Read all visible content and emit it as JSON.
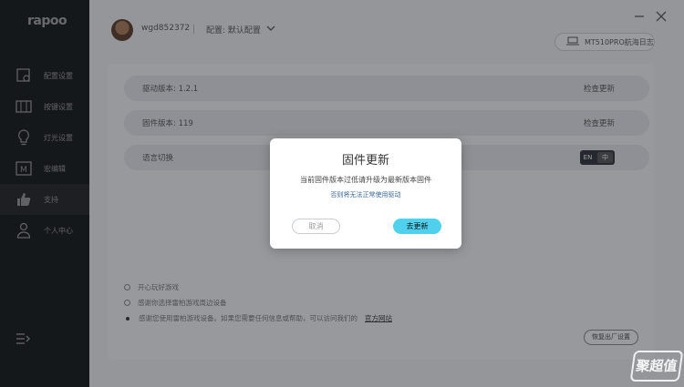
{
  "app": {
    "logo": "rapoo"
  },
  "sidebar": {
    "items": [
      {
        "label": "配置设置",
        "icon": "profile-settings-icon"
      },
      {
        "label": "按键设置",
        "icon": "keyboard-icon"
      },
      {
        "label": "灯光设置",
        "icon": "lightbulb-icon"
      },
      {
        "label": "宏编辑",
        "icon": "macro-icon"
      },
      {
        "label": "支持",
        "icon": "thumbs-up-icon",
        "active": true
      },
      {
        "label": "个人中心",
        "icon": "user-icon"
      }
    ],
    "bottom_icon": "collapse-menu-icon"
  },
  "header": {
    "username": "wgd852372",
    "profile_label": "配置: 默认配置",
    "log_button": "MT510PRO航海日志"
  },
  "support": {
    "driver_version": "驱动版本: 1.2.1",
    "driver_check": "检查更新",
    "firmware_version": "固件版本: 119",
    "firmware_check": "检查更新",
    "language_label": "语言切换",
    "lang_en": "EN",
    "lang_zh": "中",
    "notes": [
      "开心玩好游戏",
      "感谢你选择雷柏游戏周边设备",
      "感谢您使用雷柏游戏设备。如果您需要任何信息或帮助，可以访问我们的"
    ],
    "notes_link": "官方网站",
    "reset_button": "恢复出厂设置"
  },
  "dialog": {
    "title": "固件更新",
    "message": "当前固件版本过低请升级为最新版本固件",
    "sub_message": "否则将无法正常使用驱动",
    "cancel": "取消",
    "confirm": "去更新"
  },
  "watermark": "聚超值",
  "colors": {
    "accent": "#4fd1ee",
    "sidebar": "#1d1f22"
  }
}
